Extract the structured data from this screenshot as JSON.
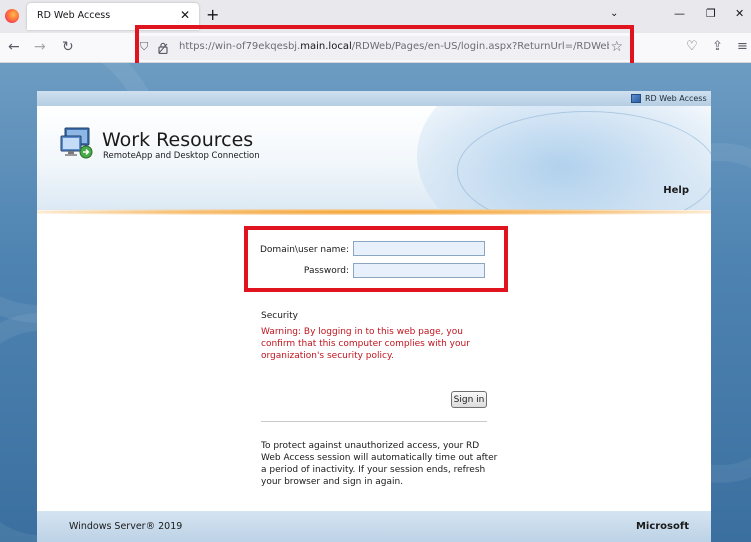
{
  "browser": {
    "tab_title": "RD Web Access",
    "tab_close": "✕",
    "new_tab": "+",
    "list_tabs": "⌄",
    "window_min": "—",
    "window_max": "❐",
    "window_close": "✕",
    "url_prefix": "https://win-of79ekqesbj.",
    "url_host": "main.local",
    "url_path": "/RDWeb/Pages/en-US/login.aspx?ReturnUrl=/RDWeb/Pag",
    "back_icon": "←",
    "forward_icon": "→",
    "reload_icon": "↻",
    "shield_icon": "⛉",
    "star_icon": "☆",
    "pocket_icon": "♡",
    "extensions_icon": "⇪",
    "menu_icon": "≡"
  },
  "page": {
    "top_badge": "RD Web Access",
    "title": "Work Resources",
    "subtitle": "RemoteApp and Desktop Connection",
    "help": "Help",
    "form": {
      "username_label": "Domain\\user name:",
      "username_value": "",
      "password_label": "Password:",
      "password_value": ""
    },
    "security_title": "Security",
    "warning": "Warning: By logging in to this web page, you confirm that this computer complies with your organization's security policy.",
    "signin_label": "Sign in",
    "notice": "To protect against unauthorized access, your RD Web Access session will automatically time out after a period of inactivity. If your session ends, refresh your browser and sign in again.",
    "footer_left": "Windows Server® 2019",
    "footer_right": "Microsoft"
  },
  "colors": {
    "highlight_box": "#e0141f",
    "warning_text": "#c0141e",
    "accent_orange": "#f6a12b"
  }
}
